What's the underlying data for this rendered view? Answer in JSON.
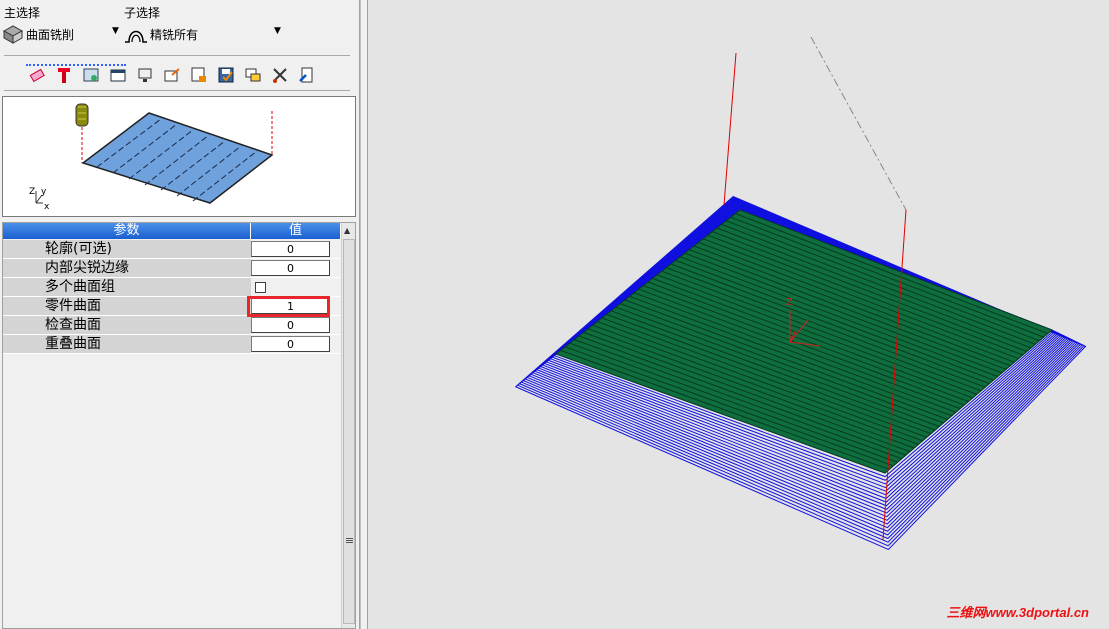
{
  "selectors": {
    "main_label": "主选择",
    "main_value": "曲面铣削",
    "sub_label": "子选择",
    "sub_value": "精铣所有"
  },
  "toolbar_icons": [
    "eraser-icon",
    "tool-icon",
    "filter-icon",
    "dialog-icon",
    "monitor-icon",
    "export-icon",
    "list-icon",
    "save-icon",
    "swap-icon",
    "scissors-icon",
    "exit-icon"
  ],
  "table": {
    "header_param": "参数",
    "header_value": "值",
    "rows": [
      {
        "label": "轮廓(可选)",
        "value": "0"
      },
      {
        "label": "内部尖锐边缘",
        "value": "0"
      },
      {
        "label": "多个曲面组",
        "value": ""
      },
      {
        "label": "零件曲面",
        "value": "1"
      },
      {
        "label": "检查曲面",
        "value": "0"
      },
      {
        "label": "重叠曲面",
        "value": "0"
      }
    ]
  },
  "preview": {
    "axis_z": "Z",
    "axis_y": "y",
    "axis_x": "x"
  },
  "viewport": {
    "axis_label": "Z",
    "watermark": "三维网www.3dportal.cn"
  },
  "colors": {
    "header_blue": "#1a5fd0",
    "highlight_red": "#e8262c",
    "surface_green": "#0f6e3e",
    "toolpath_blue": "#1010e0",
    "toolpath_red": "#e00000"
  }
}
